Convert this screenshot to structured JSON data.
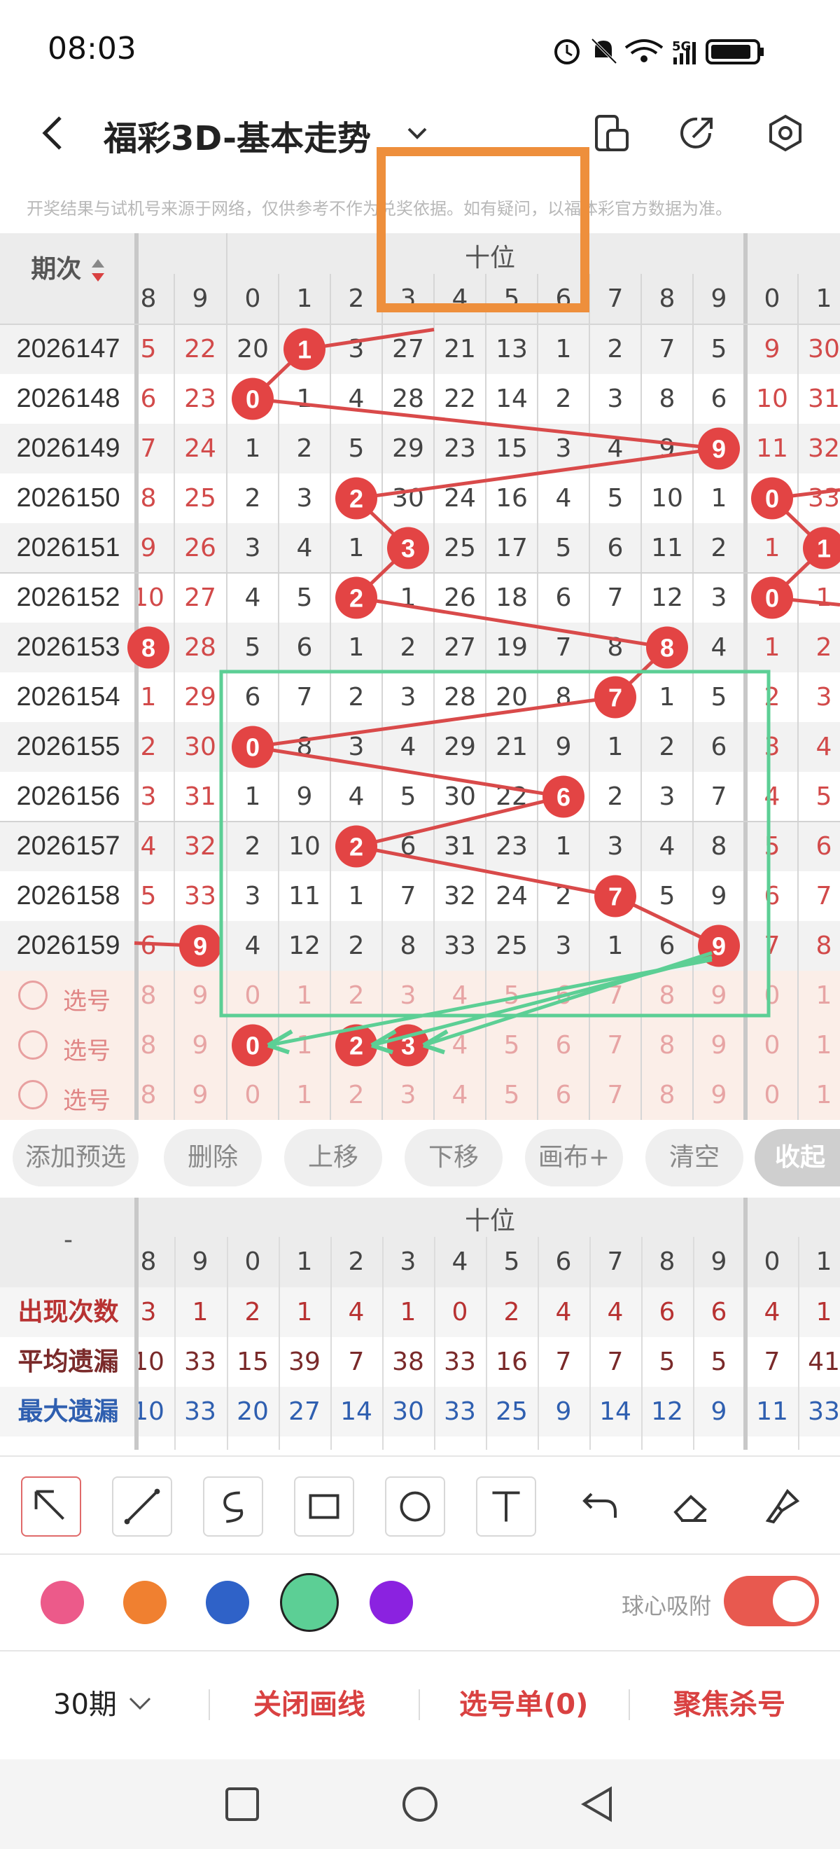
{
  "status_bar": {
    "time": "08:03",
    "network": "5G"
  },
  "header": {
    "title": "福彩3D-基本走势",
    "back_icon": "back-arrow-icon",
    "dropdown_icon": "chevron-down-icon",
    "icons": [
      "phone-rotate-icon",
      "share-icon",
      "settings-icon"
    ]
  },
  "notice": "开奖结果与试机号来源于网络，仅供参考不作为兑奖依据。如有疑问，以福体彩官方数据为准。",
  "table": {
    "issue_header": "期次",
    "group_label": "十位",
    "prev_digit_headers": [
      "8",
      "9"
    ],
    "digit_headers": [
      "0",
      "1",
      "2",
      "3",
      "4",
      "5",
      "6",
      "7",
      "8",
      "9"
    ],
    "next_digit_headers": [
      "0",
      "1"
    ],
    "rows": [
      {
        "issue": "2026147",
        "prev": [
          "5",
          "22"
        ],
        "cells": [
          "20",
          "1",
          "3",
          "27",
          "21",
          "13",
          "1",
          "2",
          "7",
          "5"
        ],
        "next": [
          "9",
          "30"
        ],
        "hit": 1,
        "prev_hit": -1,
        "next_hit": -1
      },
      {
        "issue": "2026148",
        "prev": [
          "6",
          "23"
        ],
        "cells": [
          "0",
          "1",
          "4",
          "28",
          "22",
          "14",
          "2",
          "3",
          "8",
          "6"
        ],
        "next": [
          "10",
          "31"
        ],
        "hit": 0,
        "prev_hit": -1,
        "next_hit": -1
      },
      {
        "issue": "2026149",
        "prev": [
          "7",
          "24"
        ],
        "cells": [
          "1",
          "2",
          "5",
          "29",
          "23",
          "15",
          "3",
          "4",
          "9",
          "9"
        ],
        "next": [
          "11",
          "32"
        ],
        "hit": 9,
        "prev_hit": -1,
        "next_hit": -1
      },
      {
        "issue": "2026150",
        "prev": [
          "8",
          "25"
        ],
        "cells": [
          "2",
          "3",
          "2",
          "30",
          "24",
          "16",
          "4",
          "5",
          "10",
          "1"
        ],
        "next": [
          "0",
          "33"
        ],
        "hit": 2,
        "prev_hit": -1,
        "next_hit": 0
      },
      {
        "issue": "2026151",
        "prev": [
          "9",
          "26"
        ],
        "cells": [
          "3",
          "4",
          "1",
          "3",
          "25",
          "17",
          "5",
          "6",
          "11",
          "2"
        ],
        "next": [
          "1",
          "1"
        ],
        "hit": 3,
        "prev_hit": -1,
        "next_hit": 1
      },
      {
        "issue": "2026152",
        "prev": [
          "10",
          "27"
        ],
        "cells": [
          "4",
          "5",
          "2",
          "1",
          "26",
          "18",
          "6",
          "7",
          "12",
          "3"
        ],
        "next": [
          "0",
          "1"
        ],
        "hit": 2,
        "prev_hit": -1,
        "next_hit": 0
      },
      {
        "issue": "2026153",
        "prev": [
          "8",
          "28"
        ],
        "cells": [
          "5",
          "6",
          "1",
          "2",
          "27",
          "19",
          "7",
          "8",
          "8",
          "4"
        ],
        "next": [
          "1",
          "2"
        ],
        "hit": 8,
        "prev_hit": 0,
        "next_hit": -1
      },
      {
        "issue": "2026154",
        "prev": [
          "1",
          "29"
        ],
        "cells": [
          "6",
          "7",
          "2",
          "3",
          "28",
          "20",
          "8",
          "7",
          "1",
          "5"
        ],
        "next": [
          "2",
          "3"
        ],
        "hit": 7,
        "prev_hit": -1,
        "next_hit": -1
      },
      {
        "issue": "2026155",
        "prev": [
          "2",
          "30"
        ],
        "cells": [
          "0",
          "8",
          "3",
          "4",
          "29",
          "21",
          "9",
          "1",
          "2",
          "6"
        ],
        "next": [
          "3",
          "4"
        ],
        "hit": 0,
        "prev_hit": -1,
        "next_hit": -1
      },
      {
        "issue": "2026156",
        "prev": [
          "3",
          "31"
        ],
        "cells": [
          "1",
          "9",
          "4",
          "5",
          "30",
          "22",
          "6",
          "2",
          "3",
          "7"
        ],
        "next": [
          "4",
          "5"
        ],
        "hit": 6,
        "prev_hit": -1,
        "next_hit": -1
      },
      {
        "issue": "2026157",
        "prev": [
          "4",
          "32"
        ],
        "cells": [
          "2",
          "10",
          "2",
          "6",
          "31",
          "23",
          "1",
          "3",
          "4",
          "8"
        ],
        "next": [
          "5",
          "6"
        ],
        "hit": 2,
        "prev_hit": -1,
        "next_hit": -1
      },
      {
        "issue": "2026158",
        "prev": [
          "5",
          "33"
        ],
        "cells": [
          "3",
          "11",
          "1",
          "7",
          "32",
          "24",
          "2",
          "7",
          "5",
          "9"
        ],
        "next": [
          "6",
          "7"
        ],
        "hit": 7,
        "prev_hit": -1,
        "next_hit": -1
      },
      {
        "issue": "2026159",
        "prev": [
          "6",
          "9"
        ],
        "cells": [
          "4",
          "12",
          "2",
          "8",
          "33",
          "25",
          "3",
          "1",
          "6",
          "9"
        ],
        "next": [
          "7",
          "8"
        ],
        "hit": 9,
        "prev_hit": 1,
        "next_hit": -1
      }
    ],
    "select_label": "选号",
    "select_rows": [
      {
        "prev": [
          "8",
          "9"
        ],
        "cells": [
          "0",
          "1",
          "2",
          "3",
          "4",
          "5",
          "6",
          "7",
          "8",
          "9"
        ],
        "next": [
          "0",
          "1"
        ],
        "picked": []
      },
      {
        "prev": [
          "8",
          "9"
        ],
        "cells": [
          "0",
          "1",
          "2",
          "3",
          "4",
          "5",
          "6",
          "7",
          "8",
          "9"
        ],
        "next": [
          "0",
          "1"
        ],
        "picked": [
          0,
          2,
          3
        ]
      },
      {
        "prev": [
          "8",
          "9"
        ],
        "cells": [
          "0",
          "1",
          "2",
          "3",
          "4",
          "5",
          "6",
          "7",
          "8",
          "9"
        ],
        "next": [
          "0",
          "1"
        ],
        "picked": []
      }
    ]
  },
  "actions": [
    "添加预选",
    "删除",
    "上移",
    "下移",
    "画布+",
    "清空",
    "收起"
  ],
  "stats": {
    "corner": "-",
    "group_label": "十位",
    "rows": [
      {
        "label": "出现次数",
        "prev": [
          "3",
          "1"
        ],
        "cells": [
          "2",
          "1",
          "4",
          "1",
          "0",
          "2",
          "4",
          "4",
          "6",
          "6"
        ],
        "next": [
          "4",
          "1"
        ],
        "color": "#b83232"
      },
      {
        "label": "平均遗漏",
        "prev": [
          "10",
          "33"
        ],
        "cells": [
          "15",
          "39",
          "7",
          "38",
          "33",
          "16",
          "7",
          "7",
          "5",
          "5"
        ],
        "next": [
          "7",
          "41"
        ],
        "color": "#7a2a2a"
      },
      {
        "label": "最大遗漏",
        "prev": [
          "10",
          "33"
        ],
        "cells": [
          "20",
          "27",
          "14",
          "30",
          "33",
          "25",
          "9",
          "14",
          "12",
          "9"
        ],
        "next": [
          "11",
          "33"
        ],
        "color": "#2f5fb0"
      }
    ]
  },
  "drawing_tools": [
    "select-arrow-icon",
    "line-icon",
    "curve-icon",
    "rectangle-icon",
    "circle-icon",
    "text-icon",
    "undo-icon",
    "eraser-icon",
    "brush-icon"
  ],
  "colors": [
    "#ec5a8a",
    "#f08030",
    "#2f62c8",
    "#5ccf95",
    "#8b22e0"
  ],
  "selected_color": "#5ccf95",
  "snap": {
    "label": "球心吸附",
    "on": true
  },
  "bottom_bar": {
    "period": "30期",
    "close_lines": "关闭画线",
    "pick_list": "选号单(0)",
    "focus_kill": "聚焦杀号"
  },
  "annotations": {
    "rect_orange": "#ee8f3c",
    "rect_green": "#5ccf95",
    "trend_line": "#d94a4a"
  }
}
